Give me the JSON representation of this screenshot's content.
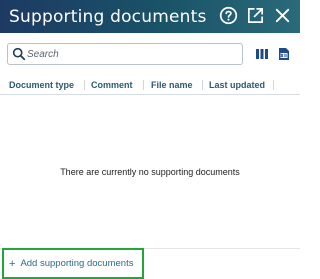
{
  "header": {
    "title": "Supporting documents",
    "icons": [
      "help-icon",
      "open-external-icon",
      "close-icon"
    ]
  },
  "toolbar": {
    "search_placeholder": "Search",
    "buttons": [
      "columns-icon",
      "export-excel-icon"
    ]
  },
  "table": {
    "columns": [
      "Document type",
      "Comment",
      "File name",
      "Last updated"
    ],
    "empty_message": "There are currently no supporting documents"
  },
  "footer": {
    "add_plus": "+",
    "add_label": "Add supporting documents"
  },
  "colors": {
    "header_start": "#1d3a63",
    "header_end": "#2a6a7a",
    "link": "#2c6a88",
    "highlight_border": "#23a53a"
  }
}
